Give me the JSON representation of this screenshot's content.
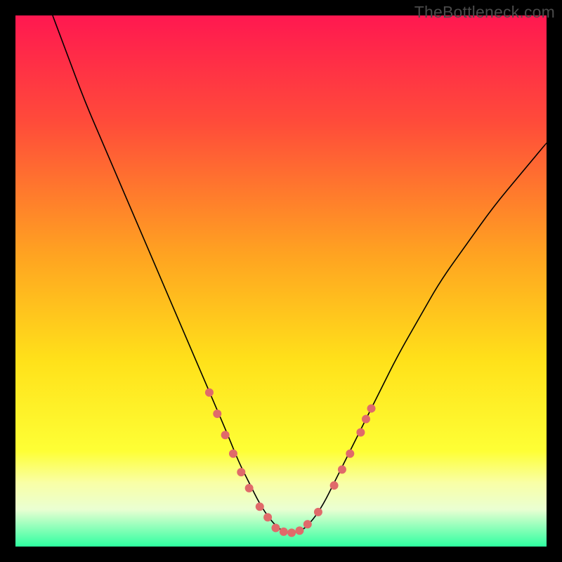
{
  "watermark": "TheBottleneck.com",
  "chart_data": {
    "type": "line",
    "title": "",
    "xlabel": "",
    "ylabel": "",
    "xlim": [
      0,
      100
    ],
    "ylim": [
      0,
      100
    ],
    "grid": false,
    "axes_visible": false,
    "background_gradient": {
      "stops": [
        {
          "offset": 0.0,
          "color": "#ff1850"
        },
        {
          "offset": 0.2,
          "color": "#ff4b3a"
        },
        {
          "offset": 0.45,
          "color": "#ffa321"
        },
        {
          "offset": 0.65,
          "color": "#ffe11a"
        },
        {
          "offset": 0.82,
          "color": "#feff35"
        },
        {
          "offset": 0.88,
          "color": "#f9ffa6"
        },
        {
          "offset": 0.93,
          "color": "#eaffd2"
        },
        {
          "offset": 1.0,
          "color": "#2effa0"
        }
      ]
    },
    "series": [
      {
        "name": "bottleneck-curve",
        "color": "#000000",
        "width": 1.6,
        "x": [
          7,
          10,
          13,
          16,
          19,
          22,
          25,
          28,
          31,
          34,
          37,
          40,
          42,
          44,
          46,
          48,
          50,
          52,
          54,
          56,
          58,
          60,
          63,
          66,
          69,
          72,
          76,
          80,
          85,
          90,
          95,
          100
        ],
        "y": [
          100,
          92,
          84,
          77,
          70,
          63,
          56,
          49,
          42,
          35,
          28,
          21,
          16,
          12,
          8,
          5,
          3,
          2.5,
          3,
          5,
          8,
          12,
          18,
          24,
          30,
          36,
          43,
          50,
          57,
          64,
          70,
          76
        ]
      }
    ],
    "markers": {
      "name": "highlight-dots",
      "color": "#e06a6a",
      "radius": 6,
      "points": [
        {
          "x": 36.5,
          "y": 29
        },
        {
          "x": 38.0,
          "y": 25
        },
        {
          "x": 39.5,
          "y": 21
        },
        {
          "x": 41.0,
          "y": 17.5
        },
        {
          "x": 42.5,
          "y": 14
        },
        {
          "x": 44.0,
          "y": 11
        },
        {
          "x": 46.0,
          "y": 7.5
        },
        {
          "x": 47.5,
          "y": 5.5
        },
        {
          "x": 49.0,
          "y": 3.5
        },
        {
          "x": 50.5,
          "y": 2.8
        },
        {
          "x": 52.0,
          "y": 2.6
        },
        {
          "x": 53.5,
          "y": 3.0
        },
        {
          "x": 55.0,
          "y": 4.2
        },
        {
          "x": 57.0,
          "y": 6.5
        },
        {
          "x": 60.0,
          "y": 11.5
        },
        {
          "x": 61.5,
          "y": 14.5
        },
        {
          "x": 63.0,
          "y": 17.5
        },
        {
          "x": 65.0,
          "y": 21.5
        },
        {
          "x": 66.0,
          "y": 24.0
        },
        {
          "x": 67.0,
          "y": 26.0
        }
      ]
    }
  }
}
